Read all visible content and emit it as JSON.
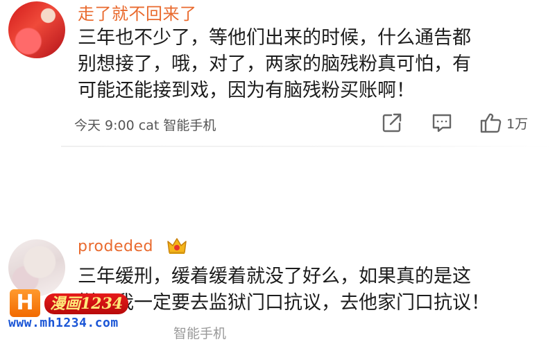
{
  "comments": [
    {
      "username": "走了就不回来了",
      "content": "三年也不少了，等他们出来的时候，什么通告都\n别想接了，哦，对了，两家的脑残粉真可怕，有\n可能还能接到戏，因为有脑残粉买账啊！",
      "meta": "今天 9:00 cat 智能手机",
      "like_count": "1万",
      "icons": [
        "share-icon",
        "comment-icon",
        "thumbs-up-icon"
      ]
    },
    {
      "username": "prodeded",
      "content": "三年缓刑，缓着缓着就没了好么，如果真的是这\n样，我一定要去监狱门口抗议，去他家门口抗议！",
      "meta_partial": "智能手机",
      "icons": [
        "crown-badge-icon"
      ]
    }
  ],
  "watermark": {
    "title": "漫画1234",
    "url": "www.mh1234.com",
    "logo_char": "H"
  },
  "colors": {
    "username": "#e96a2e",
    "text": "#1c1c1c",
    "meta": "#555555"
  }
}
